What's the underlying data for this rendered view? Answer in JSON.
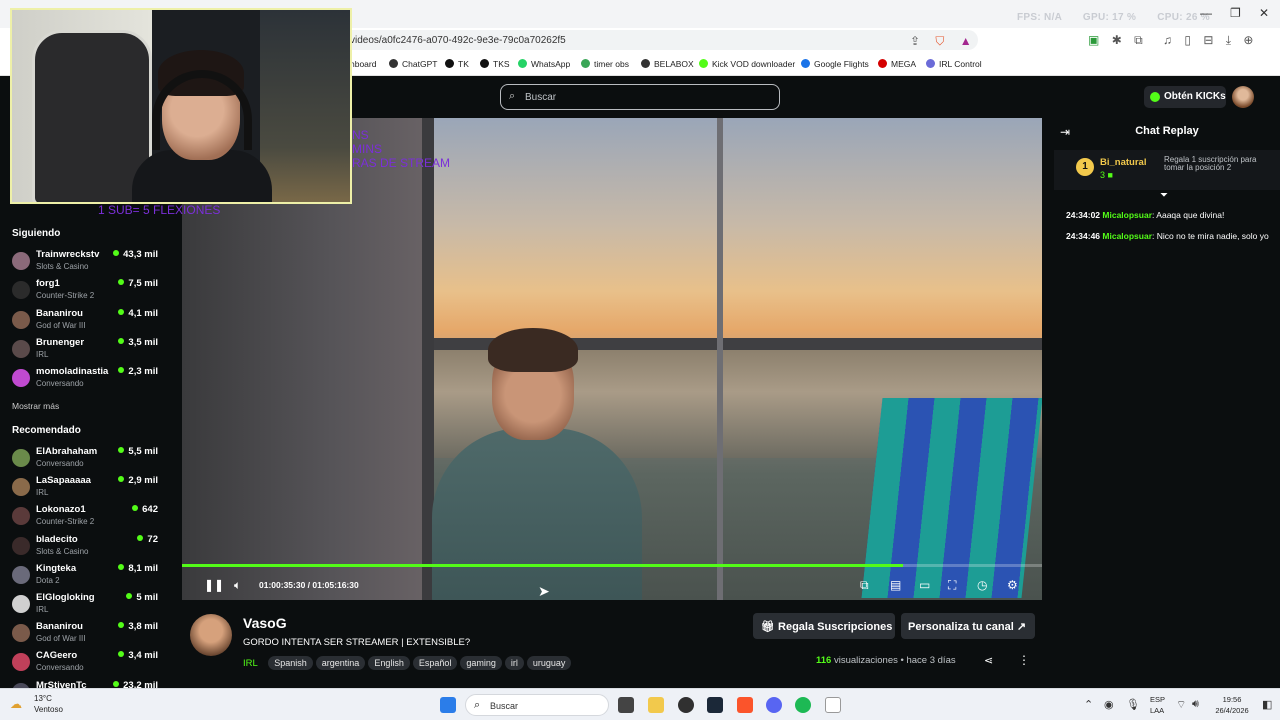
{
  "browser": {
    "url": "videos/a0fc2476-a070-492c-9e3e-79c0a70262f5",
    "stats": [
      "FPS: N/A",
      "GPU: 17 %",
      "CPU: 26 %"
    ],
    "bookmarks": [
      "hboard",
      "ChatGPT",
      "TK",
      "TKS",
      "WhatsApp",
      "timer obs",
      "BELABOX",
      "Kick VOD downloader",
      "Google Flights",
      "MEGA",
      "IRL Control"
    ],
    "bookmark_colors": [
      "#333333",
      "#333333",
      "#111111",
      "#111111",
      "#25d366",
      "#3aa657",
      "#333333",
      "#53fc18",
      "#1a73e8",
      "#d40000",
      "#6b6bd8"
    ]
  },
  "header": {
    "search_placeholder": "Buscar",
    "kicks_label": "Obtén KICKs"
  },
  "sidebar": {
    "following_title": "Siguiendo",
    "following": [
      {
        "name": "Trainwreckstv",
        "category": "Slots & Casino",
        "viewers": "43,3 mil",
        "color": "#8b6a7a"
      },
      {
        "name": "forg1",
        "category": "Counter-Strike 2",
        "viewers": "7,5 mil",
        "color": "#2b2b2b"
      },
      {
        "name": "Bananirou",
        "category": "God of War III",
        "viewers": "4,1 mil",
        "color": "#7a5a4a"
      },
      {
        "name": "Brunenger",
        "category": "IRL",
        "viewers": "3,5 mil",
        "color": "#5a4a4a"
      },
      {
        "name": "momoladinastia",
        "category": "Conversando",
        "viewers": "2,3 mil",
        "color": "#c04ad0"
      }
    ],
    "show_more": "Mostrar más",
    "recommended_title": "Recomendado",
    "recommended": [
      {
        "name": "ElAbrahaham",
        "category": "Conversando",
        "viewers": "5,5 mil",
        "color": "#6a8a4a"
      },
      {
        "name": "LaSapaaaaa",
        "category": "IRL",
        "viewers": "2,9 mil",
        "color": "#8a6a4a"
      },
      {
        "name": "Lokonazo1",
        "category": "Counter-Strike 2",
        "viewers": "642",
        "color": "#5a3a3a"
      },
      {
        "name": "bladecito",
        "category": "Slots & Casino",
        "viewers": "72",
        "color": "#3a2a2a"
      },
      {
        "name": "Kingteka",
        "category": "Dota 2",
        "viewers": "8,1 mil",
        "color": "#6a6a7a"
      },
      {
        "name": "ElGlogloking",
        "category": "IRL",
        "viewers": "5 mil",
        "color": "#d0d0d0"
      },
      {
        "name": "Bananirou",
        "category": "God of War III",
        "viewers": "3,8 mil",
        "color": "#7a5a4a"
      },
      {
        "name": "CAGeero",
        "category": "Conversando",
        "viewers": "3,4 mil",
        "color": "#c0405a"
      },
      {
        "name": "MrStivenTc",
        "category": "",
        "viewers": "23,2 mil",
        "color": "#4a4a5a"
      }
    ]
  },
  "overlay": {
    "line1": "NS",
    "line2": "MINS",
    "line3": "RAS DE STREAM",
    "sub_rule": "1 SUB= 5 FLEXIONES"
  },
  "player": {
    "time": "01:00:35:30 / 01:05:16:30",
    "progress": 0.838
  },
  "chat": {
    "title": "Chat Replay",
    "pinned": {
      "rank": "1",
      "name": "Bi_natural",
      "count": "3",
      "note": "Regala 1 suscripción para tomar la posición 2"
    },
    "messages": [
      {
        "time": "24:34:02",
        "user": "Micalopsuar",
        "text": "Aaaqa que divina!"
      },
      {
        "time": "24:34:46",
        "user": "Micalopsuar",
        "text": "Nico no te mira nadie, solo yo"
      }
    ]
  },
  "channel": {
    "name": "VasoG",
    "title": "GORDO INTENTA SER STREAMER | EXTENSIBLE?",
    "category": "IRL",
    "tags": [
      "Spanish",
      "argentina",
      "English",
      "Español",
      "gaming",
      "irl",
      "uruguay"
    ],
    "gift_button": "Regala Suscripciones",
    "customize_button": "Personaliza tu canal",
    "views_count": "116",
    "views_label": "visualizaciones",
    "ago": "hace 3 días"
  },
  "taskbar": {
    "temp": "13°C",
    "weather": "Ventoso",
    "search_placeholder": "Buscar",
    "lang1": "ESP",
    "lang2": "LAA",
    "time": "19:56",
    "date": "26/4/2026"
  }
}
